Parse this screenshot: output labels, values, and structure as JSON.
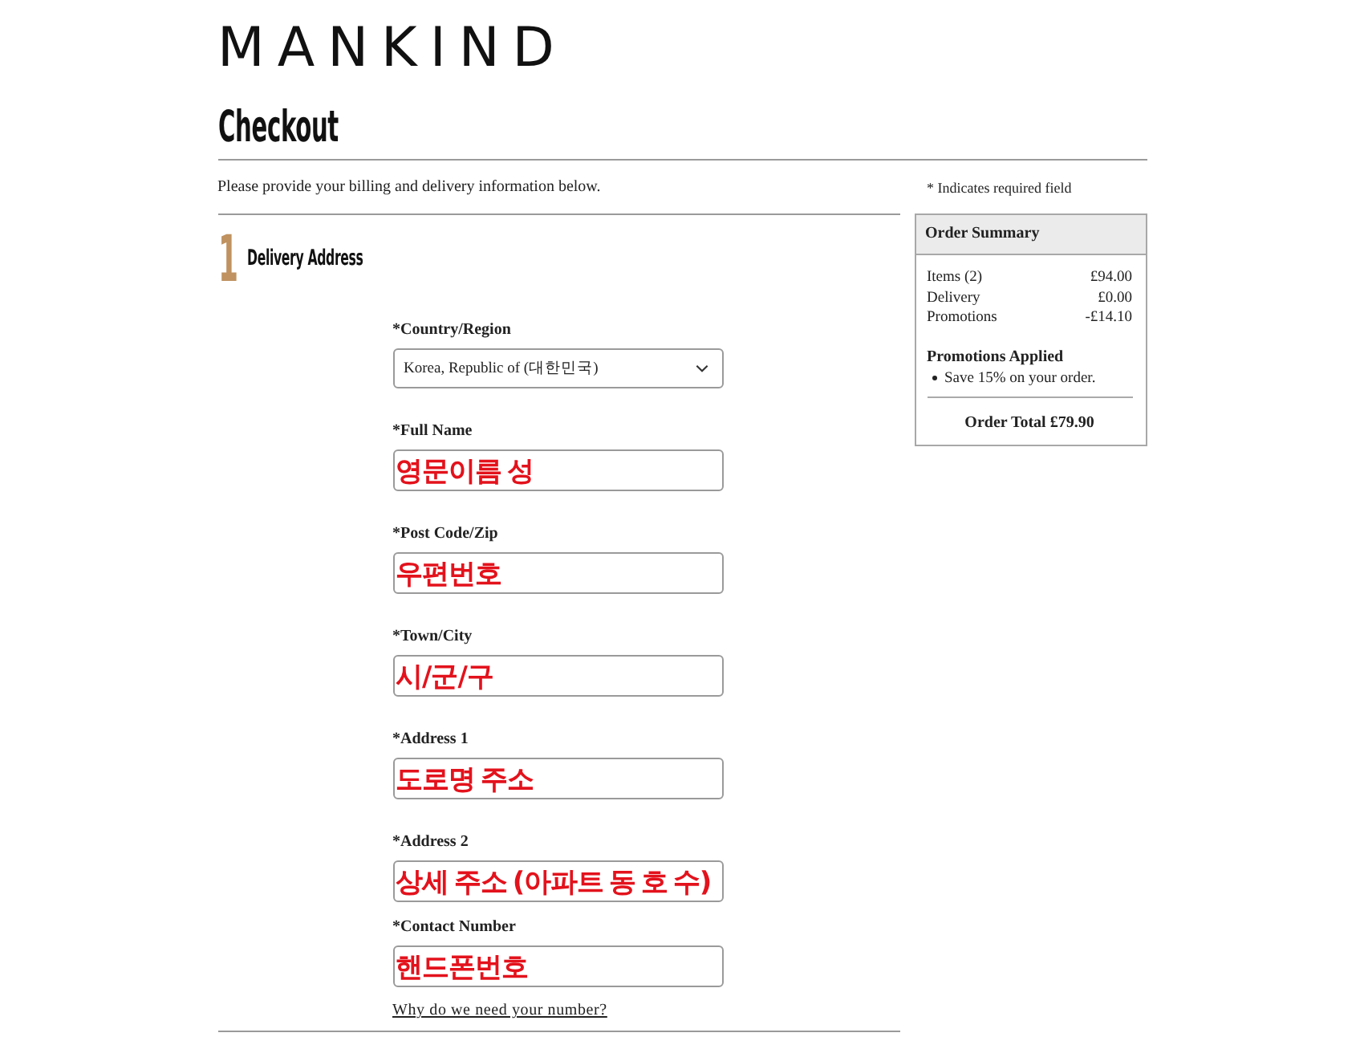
{
  "logo": {
    "text": "MANKIND"
  },
  "header": {
    "title": "Checkout",
    "intro": "Please provide your billing and delivery information below.",
    "required_note": "* Indicates required field"
  },
  "section": {
    "number": "1",
    "title": "Delivery Address"
  },
  "fields": [
    {
      "kind": "select",
      "label": "*Country/Region",
      "value": "Korea, Republic of (대한민국)"
    },
    {
      "kind": "text",
      "label": "*Full Name",
      "value": "영문이름 성"
    },
    {
      "kind": "text",
      "label": "*Post Code/Zip",
      "value": "우편번호"
    },
    {
      "kind": "text",
      "label": "*Town/City",
      "value": "시/군/구"
    },
    {
      "kind": "text",
      "label": "*Address 1",
      "value": "도로명 주소"
    },
    {
      "kind": "text",
      "label": "*Address 2",
      "value": "상세 주소 (아파트 동 호 수)"
    },
    {
      "kind": "text",
      "label": "*Contact Number",
      "value": "핸드폰번호"
    }
  ],
  "help_link": "Why do we need your number?",
  "order_summary": {
    "title": "Order Summary",
    "lines": [
      {
        "label": "Items (2)",
        "amount": "£94.00"
      },
      {
        "label": "Delivery",
        "amount": "£0.00"
      },
      {
        "label": "Promotions",
        "amount": "-£14.10"
      }
    ],
    "promotions_title": "Promotions Applied",
    "promotions": [
      "Save 15% on your order."
    ],
    "total": "Order Total £79.90"
  }
}
